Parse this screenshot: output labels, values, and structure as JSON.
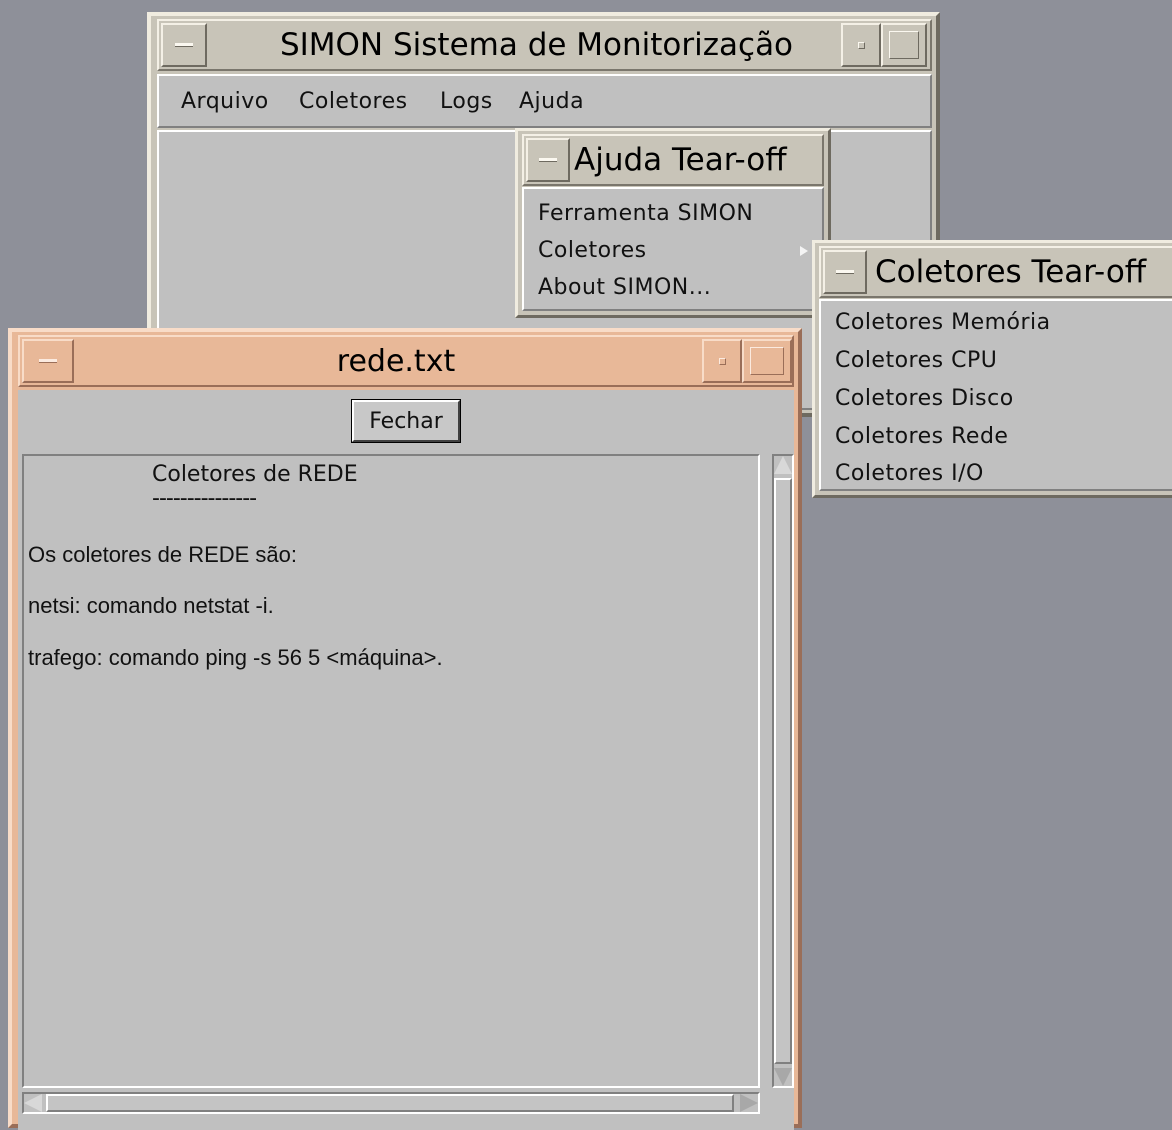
{
  "main_window": {
    "title": "SIMON Sistema de Monitorização",
    "menu": [
      "Arquivo",
      "Coletores",
      "Logs",
      "Ajuda"
    ]
  },
  "ajuda_tearoff": {
    "title": "Ajuda Tear-off",
    "items": [
      "Ferramenta SIMON",
      "Coletores",
      "About SIMON..."
    ]
  },
  "coletores_tearoff": {
    "title": "Coletores Tear-off",
    "items": [
      "Coletores Memória",
      "Coletores CPU",
      "Coletores Disco",
      "Coletores Rede",
      "Coletores I/O"
    ]
  },
  "rede_window": {
    "title": "rede.txt",
    "close_label": "Fechar",
    "heading": "Coletores de REDE",
    "underline": "---------------",
    "lines": [
      "Os coletores de REDE são:",
      "netsi: comando netstat -i.",
      "trafego: comando ping -s 56 5 <máquina>."
    ]
  },
  "colors": {
    "desktop": "#8e9099",
    "inactive_frame": "#c8c4b8",
    "active_frame": "#e8b898",
    "panel": "#c0c0c0"
  }
}
